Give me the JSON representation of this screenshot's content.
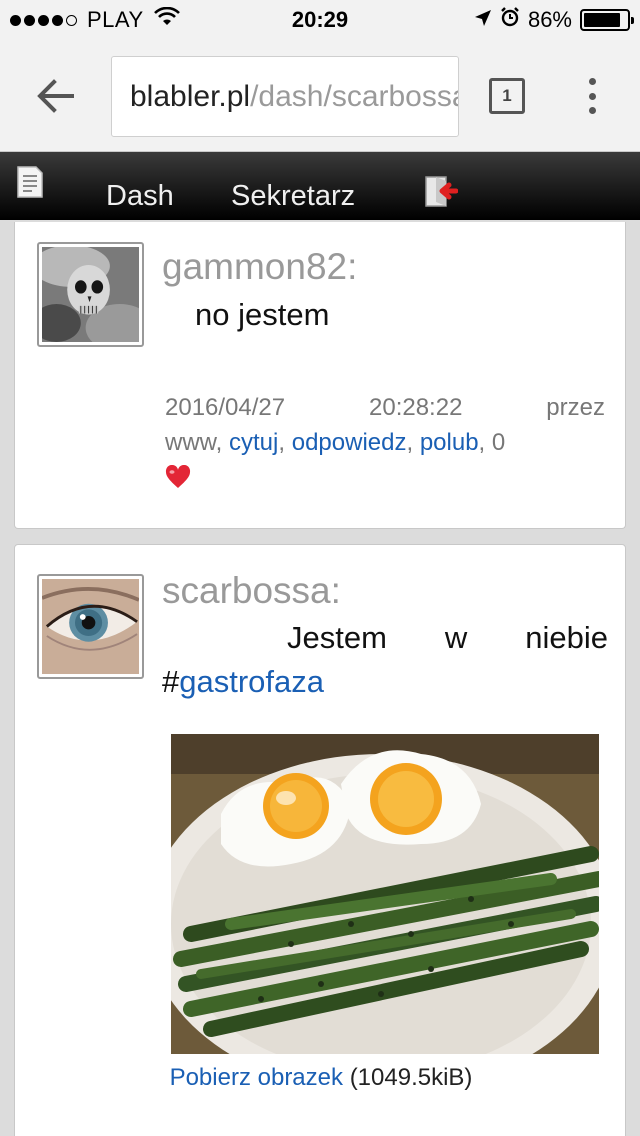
{
  "status_bar": {
    "carrier": "PLAY",
    "time": "20:29",
    "battery_percent": "86%",
    "battery_level": 0.86
  },
  "browser": {
    "url_host": "blabler.pl",
    "url_path": "/dash/scarbossa",
    "tab_count": "1"
  },
  "site_nav": {
    "items": [
      {
        "label": "Dash"
      },
      {
        "label": "Sekretarz"
      }
    ]
  },
  "posts": [
    {
      "author": "gammon82:",
      "text": "no jestem",
      "date": "2016/04/27",
      "time": "20:28:22",
      "via_prefix": "przez",
      "via": "www,",
      "actions": {
        "quote": "cytuj",
        "reply": "odpowiedz",
        "like": "polub"
      },
      "sep": ",",
      "likes": "0",
      "colors": {
        "link": "#1a5fb4",
        "heart": "#e32636"
      }
    },
    {
      "author": "scarbossa:",
      "text_words": [
        "Jestem",
        "w",
        "niebie"
      ],
      "hashtag_prefix": "#",
      "hashtag": "gastrofaza",
      "download_label": "Pobierz obrazek",
      "file_size": "(1049.5kiB)"
    }
  ]
}
